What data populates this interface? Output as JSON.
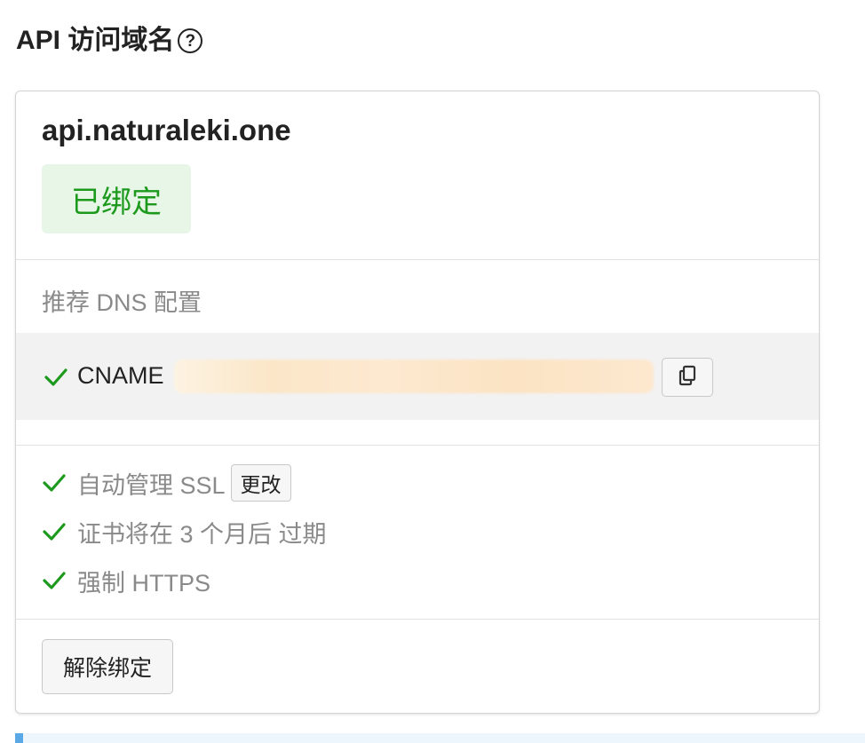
{
  "section": {
    "title": "API 访问域名",
    "help_icon": "question-circle-icon",
    "help_glyph": "?"
  },
  "card": {
    "domain": "api.naturaleki.one",
    "status_badge": "已绑定",
    "dns": {
      "label": "推荐 DNS 配置",
      "record_type": "CNAME",
      "record_value": "",
      "copy_icon": "copy-icon"
    },
    "features": [
      {
        "text": "自动管理 SSL",
        "action_label": "更改"
      },
      {
        "text": "证书将在 3 个月后 过期"
      },
      {
        "text": "强制 HTTPS"
      }
    ],
    "unbind_label": "解除绑定"
  },
  "colors": {
    "success_green": "#1d9a1d",
    "badge_bg": "#e7f6e6",
    "muted_text": "#8a8a8a",
    "dns_row_bg": "#f2f2f2",
    "info_accent": "#5aa9e6"
  }
}
